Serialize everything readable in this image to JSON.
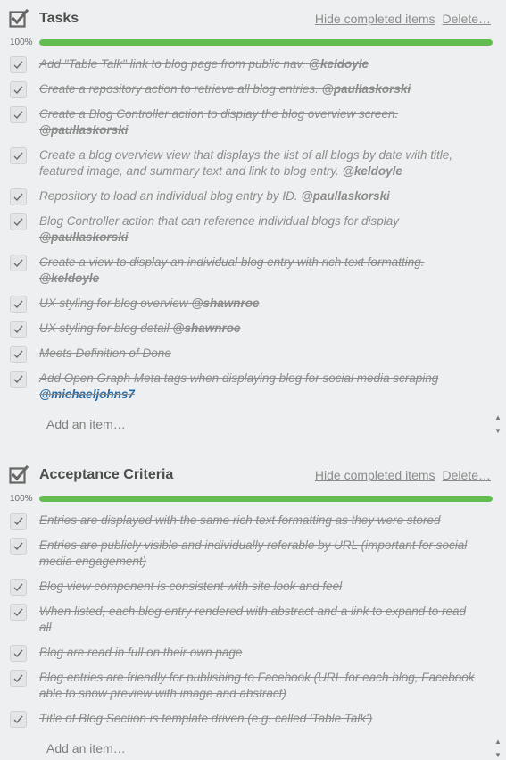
{
  "checklists": [
    {
      "title": "Tasks",
      "hide_completed": "Hide completed items",
      "delete": "Delete…",
      "progress_label": "100%",
      "progress": 1.0,
      "items": [
        {
          "text": "Add \"Table Talk\" link to blog page from public nav.",
          "mention": "@keldoyle",
          "checked": true
        },
        {
          "text": "Create a repository action to retrieve all blog entries.",
          "mention": "@paullaskorski",
          "checked": true
        },
        {
          "text": "Create a Blog Controller action to display the blog overview screen.",
          "mention": "@paullaskorski",
          "checked": true
        },
        {
          "text": "Create a blog overview view that displays the list of all blogs by date with title, featured image, and summary text and link to blog entry.",
          "mention": "@keldoyle",
          "checked": true
        },
        {
          "text": "Repository to load an individual blog entry by ID.",
          "mention": "@paullaskorski",
          "checked": true
        },
        {
          "text": "Blog Controller action that can reference individual blogs for display",
          "mention": "@paullaskorski",
          "checked": true
        },
        {
          "text": "Create a view to display an individual blog entry with rich text formatting.",
          "mention": "@keldoyle",
          "checked": true
        },
        {
          "text": "UX styling for blog overview",
          "mention": "@shawnroe",
          "checked": true
        },
        {
          "text": "UX styling for blog detail",
          "mention": "@shawnroe",
          "checked": true
        },
        {
          "text": "Meets Definition of Done",
          "mention": "",
          "checked": true
        },
        {
          "text": "Add Open Graph Meta tags when displaying blog for social media scraping",
          "mention": "@michaeljohns7",
          "checked": true,
          "mention_link": true
        }
      ],
      "add_placeholder": "Add an item…"
    },
    {
      "title": "Acceptance Criteria",
      "hide_completed": "Hide completed items",
      "delete": "Delete…",
      "progress_label": "100%",
      "progress": 1.0,
      "items": [
        {
          "text": "Entries are displayed with the same rich text formatting as they were stored",
          "mention": "",
          "checked": true
        },
        {
          "text": "Entries are publicly visible and individually referable by URL (important for social media engagement)",
          "mention": "",
          "checked": true
        },
        {
          "text": "Blog view component is consistent with site look and feel",
          "mention": "",
          "checked": true
        },
        {
          "text": "When listed, each blog entry rendered with abstract and a link to expand to read all",
          "mention": "",
          "checked": true
        },
        {
          "text": "Blog are read in full on their own page",
          "mention": "",
          "checked": true
        },
        {
          "text": "Blog entries are friendly for publishing to Facebook (URL for each blog, Facebook able to show preview with image and abstract)",
          "mention": "",
          "checked": true
        },
        {
          "text": "Title of Blog Section is template driven (e.g. called 'Table Talk')",
          "mention": "",
          "checked": true
        }
      ],
      "add_placeholder": "Add an item…"
    }
  ],
  "colors": {
    "progress_fill": "#61bd4f",
    "mention_link": "#2b6aa5",
    "completed_text": "#8c8c8c"
  },
  "icons": {
    "checklist_header": "checklist-icon",
    "item_check": "checkmark-icon",
    "spinner": "up-down-spinner-icon"
  }
}
